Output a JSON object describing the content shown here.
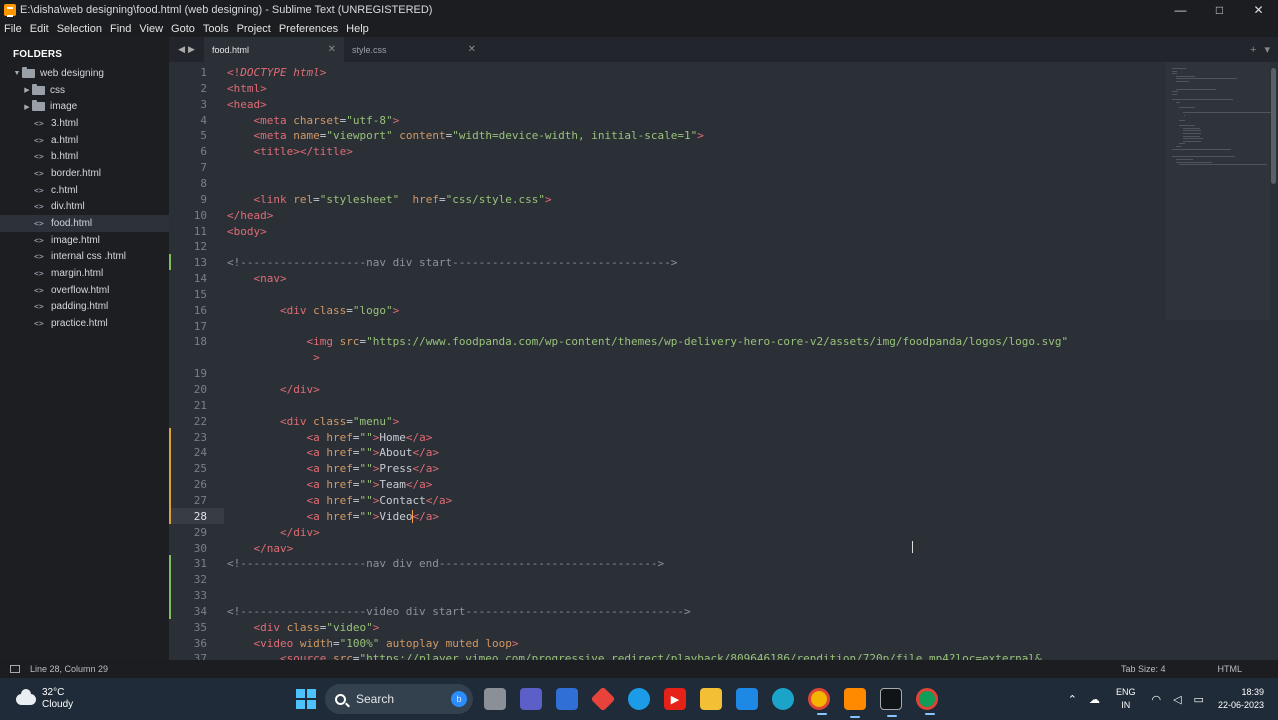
{
  "window": {
    "title": "E:\\disha\\web designing\\food.html (web designing) - Sublime Text (UNREGISTERED)",
    "controls": [
      "—",
      "□",
      "✕"
    ]
  },
  "menu": [
    "File",
    "Edit",
    "Selection",
    "Find",
    "View",
    "Goto",
    "Tools",
    "Project",
    "Preferences",
    "Help"
  ],
  "sidebar": {
    "heading": "FOLDERS",
    "root": "web designing",
    "folders": [
      "css",
      "image"
    ],
    "files": [
      "3.html",
      "a.html",
      "b.html",
      "border.html",
      "c.html",
      "div.html",
      "food.html",
      "image.html",
      "internal css .html",
      "margin.html",
      "overflow.html",
      "padding.html",
      "practice.html"
    ],
    "selected": "food.html"
  },
  "tabs": [
    {
      "label": "food.html",
      "active": true
    },
    {
      "label": "style.css",
      "active": false
    }
  ],
  "editor": {
    "current_line": 28,
    "lines": [
      {
        "n": "1",
        "parts": [
          [
            "t",
            "<!"
          ],
          [
            "d",
            "DOCTYPE"
          ],
          [
            "t",
            " "
          ],
          [
            "d",
            "html"
          ],
          [
            "t",
            ">"
          ]
        ]
      },
      {
        "n": "2",
        "parts": [
          [
            "t",
            "<html>"
          ]
        ]
      },
      {
        "n": "3",
        "parts": [
          [
            "t",
            "<head>"
          ]
        ]
      },
      {
        "n": "4",
        "parts": [
          [
            "p",
            "    "
          ],
          [
            "t",
            "<meta "
          ],
          [
            "a",
            "charset"
          ],
          [
            "p",
            "="
          ],
          [
            "s",
            "\"utf-8\""
          ],
          [
            "t",
            ">"
          ]
        ]
      },
      {
        "n": "5",
        "parts": [
          [
            "p",
            "    "
          ],
          [
            "t",
            "<meta "
          ],
          [
            "a",
            "name"
          ],
          [
            "p",
            "="
          ],
          [
            "s",
            "\"viewport\""
          ],
          [
            "p",
            " "
          ],
          [
            "a",
            "content"
          ],
          [
            "p",
            "="
          ],
          [
            "s",
            "\"width=device-width, initial-scale=1\""
          ],
          [
            "t",
            ">"
          ]
        ]
      },
      {
        "n": "6",
        "parts": [
          [
            "p",
            "    "
          ],
          [
            "t",
            "<title></title>"
          ]
        ]
      },
      {
        "n": "7",
        "parts": []
      },
      {
        "n": "8",
        "parts": []
      },
      {
        "n": "9",
        "parts": [
          [
            "p",
            "    "
          ],
          [
            "t",
            "<link "
          ],
          [
            "a",
            "rel"
          ],
          [
            "p",
            "="
          ],
          [
            "s",
            "\"stylesheet\""
          ],
          [
            "p",
            "  "
          ],
          [
            "a",
            "href"
          ],
          [
            "p",
            "="
          ],
          [
            "s",
            "\"css/style.css\""
          ],
          [
            "t",
            ">"
          ]
        ]
      },
      {
        "n": "10",
        "parts": [
          [
            "t",
            "</head>"
          ]
        ]
      },
      {
        "n": "11",
        "parts": [
          [
            "t",
            "<body>"
          ]
        ]
      },
      {
        "n": "12",
        "parts": []
      },
      {
        "n": "13",
        "parts": [
          [
            "c",
            "<!-------------------nav div start--------------------------------->"
          ]
        ]
      },
      {
        "n": "14",
        "parts": [
          [
            "p",
            "    "
          ],
          [
            "t",
            "<nav>"
          ]
        ]
      },
      {
        "n": "15",
        "parts": []
      },
      {
        "n": "16",
        "parts": [
          [
            "p",
            "        "
          ],
          [
            "t",
            "<div "
          ],
          [
            "a",
            "class"
          ],
          [
            "p",
            "="
          ],
          [
            "s",
            "\"logo\""
          ],
          [
            "t",
            ">"
          ]
        ]
      },
      {
        "n": "17",
        "parts": []
      },
      {
        "n": "18",
        "parts": [
          [
            "p",
            "            "
          ],
          [
            "t",
            "<img "
          ],
          [
            "a",
            "src"
          ],
          [
            "p",
            "="
          ],
          [
            "s",
            "\"https://www.foodpanda.com/wp-content/themes/wp-delivery-hero-core-v2/assets/img/foodpanda/logos/logo.svg\""
          ]
        ]
      },
      {
        "n": "",
        "parts": [
          [
            "p",
            "             "
          ],
          [
            "t",
            ">"
          ]
        ]
      },
      {
        "n": "19",
        "parts": []
      },
      {
        "n": "20",
        "parts": [
          [
            "p",
            "        "
          ],
          [
            "t",
            "</div>"
          ]
        ]
      },
      {
        "n": "21",
        "parts": []
      },
      {
        "n": "22",
        "parts": [
          [
            "p",
            "        "
          ],
          [
            "t",
            "<div "
          ],
          [
            "a",
            "class"
          ],
          [
            "p",
            "="
          ],
          [
            "s",
            "\"menu\""
          ],
          [
            "t",
            ">"
          ]
        ]
      },
      {
        "n": "23",
        "parts": [
          [
            "p",
            "            "
          ],
          [
            "t",
            "<a "
          ],
          [
            "a",
            "href"
          ],
          [
            "p",
            "="
          ],
          [
            "s",
            "\"\""
          ],
          [
            "t",
            ">"
          ],
          [
            "p",
            "Home"
          ],
          [
            "t",
            "</a>"
          ]
        ]
      },
      {
        "n": "24",
        "parts": [
          [
            "p",
            "            "
          ],
          [
            "t",
            "<a "
          ],
          [
            "a",
            "href"
          ],
          [
            "p",
            "="
          ],
          [
            "s",
            "\"\""
          ],
          [
            "t",
            ">"
          ],
          [
            "p",
            "About"
          ],
          [
            "t",
            "</a>"
          ]
        ]
      },
      {
        "n": "25",
        "parts": [
          [
            "p",
            "            "
          ],
          [
            "t",
            "<a "
          ],
          [
            "a",
            "href"
          ],
          [
            "p",
            "="
          ],
          [
            "s",
            "\"\""
          ],
          [
            "t",
            ">"
          ],
          [
            "p",
            "Press"
          ],
          [
            "t",
            "</a>"
          ]
        ]
      },
      {
        "n": "26",
        "parts": [
          [
            "p",
            "            "
          ],
          [
            "t",
            "<a "
          ],
          [
            "a",
            "href"
          ],
          [
            "p",
            "="
          ],
          [
            "s",
            "\"\""
          ],
          [
            "t",
            ">"
          ],
          [
            "p",
            "Team"
          ],
          [
            "t",
            "</a>"
          ]
        ]
      },
      {
        "n": "27",
        "parts": [
          [
            "p",
            "            "
          ],
          [
            "t",
            "<a "
          ],
          [
            "a",
            "href"
          ],
          [
            "p",
            "="
          ],
          [
            "s",
            "\"\""
          ],
          [
            "t",
            ">"
          ],
          [
            "p",
            "Contact"
          ],
          [
            "t",
            "</a>"
          ]
        ]
      },
      {
        "n": "28",
        "parts": [
          [
            "p",
            "            "
          ],
          [
            "t",
            "<a "
          ],
          [
            "a",
            "href"
          ],
          [
            "p",
            "="
          ],
          [
            "s",
            "\"\""
          ],
          [
            "t",
            ">"
          ],
          [
            "p",
            "Video"
          ],
          [
            "k",
            ""
          ],
          [
            "t",
            "</a>"
          ]
        ]
      },
      {
        "n": "29",
        "parts": [
          [
            "p",
            "        "
          ],
          [
            "t",
            "</div>"
          ]
        ]
      },
      {
        "n": "30",
        "parts": [
          [
            "p",
            "    "
          ],
          [
            "t",
            "</nav>"
          ]
        ]
      },
      {
        "n": "31",
        "parts": [
          [
            "c",
            "<!-------------------nav div end--------------------------------->"
          ]
        ]
      },
      {
        "n": "32",
        "parts": []
      },
      {
        "n": "33",
        "parts": []
      },
      {
        "n": "34",
        "parts": [
          [
            "c",
            "<!-------------------video div start--------------------------------->"
          ]
        ]
      },
      {
        "n": "35",
        "parts": [
          [
            "p",
            "    "
          ],
          [
            "t",
            "<div "
          ],
          [
            "a",
            "class"
          ],
          [
            "p",
            "="
          ],
          [
            "s",
            "\"video\""
          ],
          [
            "t",
            ">"
          ]
        ]
      },
      {
        "n": "36",
        "parts": [
          [
            "p",
            "    "
          ],
          [
            "t",
            "<video "
          ],
          [
            "a",
            "width"
          ],
          [
            "p",
            "="
          ],
          [
            "s",
            "\"100%\""
          ],
          [
            "p",
            " "
          ],
          [
            "a",
            "autoplay"
          ],
          [
            "p",
            " "
          ],
          [
            "a",
            "muted"
          ],
          [
            "p",
            " "
          ],
          [
            "a",
            "loop"
          ],
          [
            "t",
            ">"
          ]
        ]
      },
      {
        "n": "37",
        "parts": [
          [
            "p",
            "        "
          ],
          [
            "t",
            "<source "
          ],
          [
            "a",
            "src"
          ],
          [
            "p",
            "="
          ],
          [
            "s",
            "\"https://player.vimeo.com/progressive_redirect/playback/809646186/rendition/720p/file.mp4?loc=external&"
          ]
        ]
      }
    ]
  },
  "status": {
    "position": "Line 28, Column 29",
    "tab_size": "Tab Size: 4",
    "syntax": "HTML"
  },
  "taskbar": {
    "temperature": "32°C",
    "weather": "Cloudy",
    "search_label": "Search",
    "language": "ENG",
    "region": "IN",
    "time": "18:39",
    "date": "22-06-2023"
  },
  "colors": {
    "tag": "#e06c75",
    "attribute": "#d19a66",
    "string": "#98c379",
    "comment": "#8c929c",
    "editor_bg": "#2b2f36"
  }
}
